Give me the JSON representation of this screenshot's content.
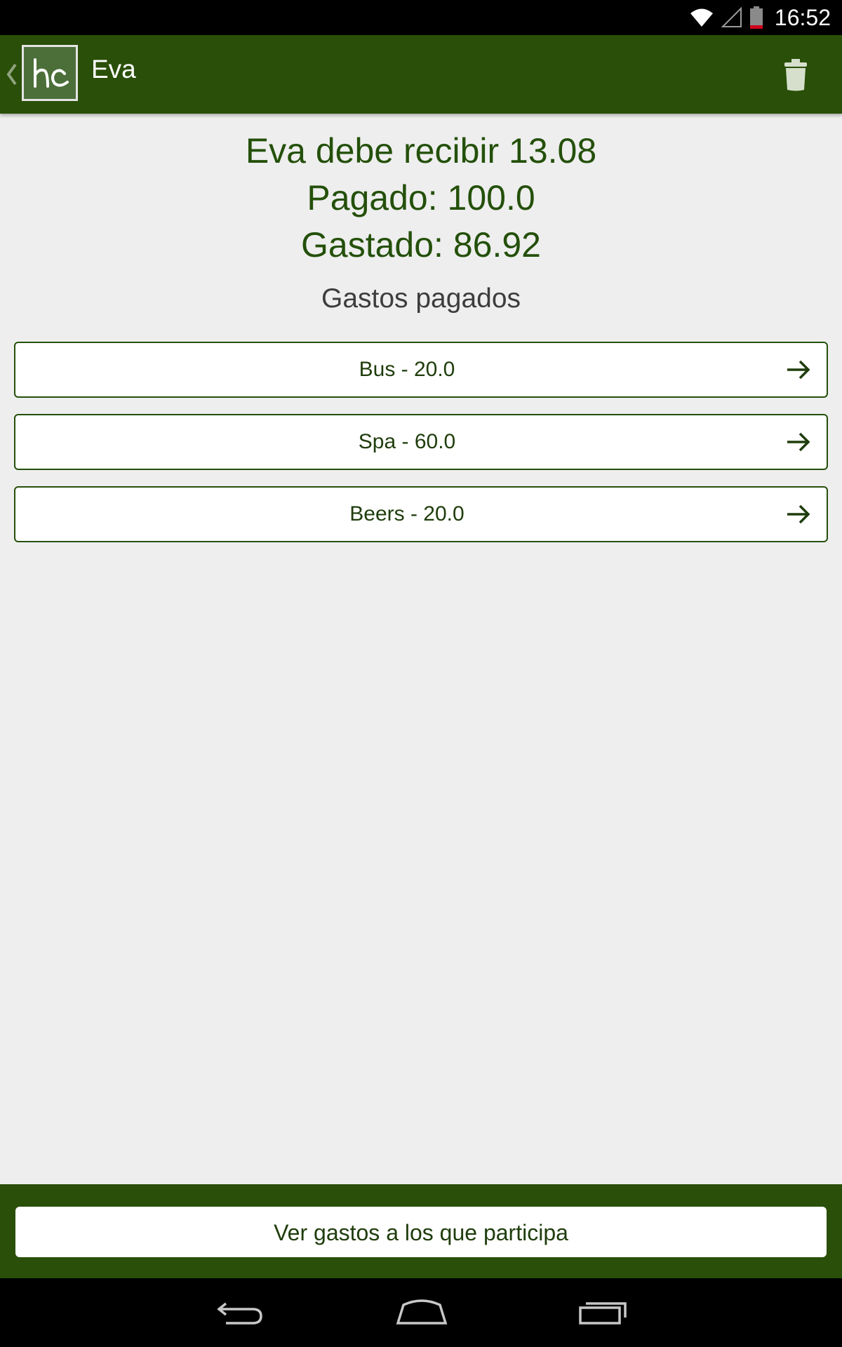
{
  "status_bar": {
    "time": "16:52",
    "icons": [
      "wifi-icon",
      "signal-icon",
      "battery-icon"
    ]
  },
  "action_bar": {
    "title": "Eva",
    "logo_text": "hc",
    "icons": [
      "back-caret-icon",
      "trash-icon"
    ]
  },
  "summary": {
    "balance": "Eva debe recibir 13.08",
    "paid": "Pagado: 100.0",
    "spent": "Gastado: 86.92"
  },
  "section_title": "Gastos pagados",
  "expenses": [
    {
      "label": "Bus - 20.0"
    },
    {
      "label": "Spa - 60.0"
    },
    {
      "label": "Beers - 20.0"
    }
  ],
  "footer": {
    "button_label": "Ver gastos a los que participa"
  },
  "nav_bar": {
    "icons": [
      "back-nav-icon",
      "home-nav-icon",
      "recents-nav-icon"
    ]
  },
  "colors": {
    "brand_green": "#2a4f08",
    "text_green": "#24500a",
    "background": "#eeeeee"
  }
}
